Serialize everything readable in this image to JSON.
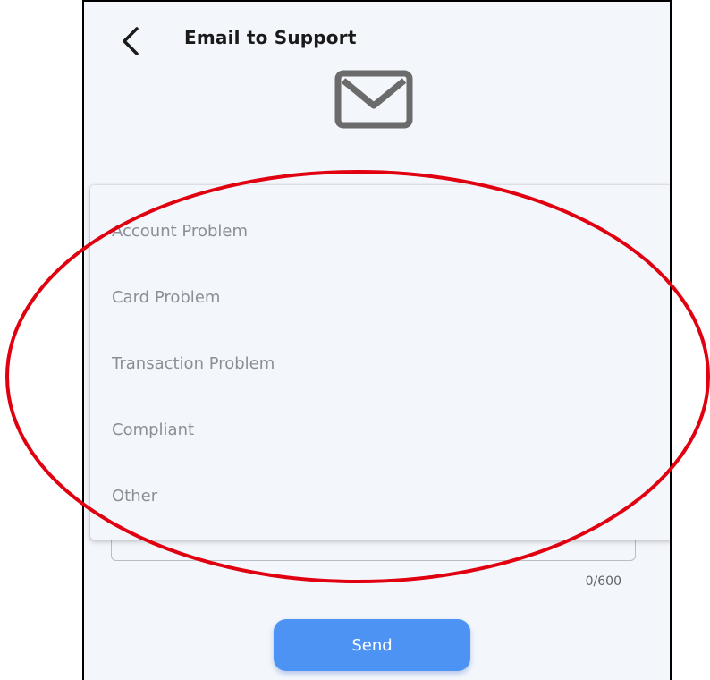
{
  "header": {
    "title": "Email to Support",
    "back_icon": "chevron-left-icon"
  },
  "hero": {
    "icon": "mail-icon"
  },
  "dropdown": {
    "options": [
      "Account Problem",
      "Card Problem",
      "Transaction Problem",
      "Compliant",
      "Other"
    ]
  },
  "message": {
    "counter": "0/600"
  },
  "actions": {
    "send_label": "Send"
  },
  "colors": {
    "accent": "#4d93f4",
    "annotation": "#e0000f",
    "background": "#f3f6fb"
  }
}
